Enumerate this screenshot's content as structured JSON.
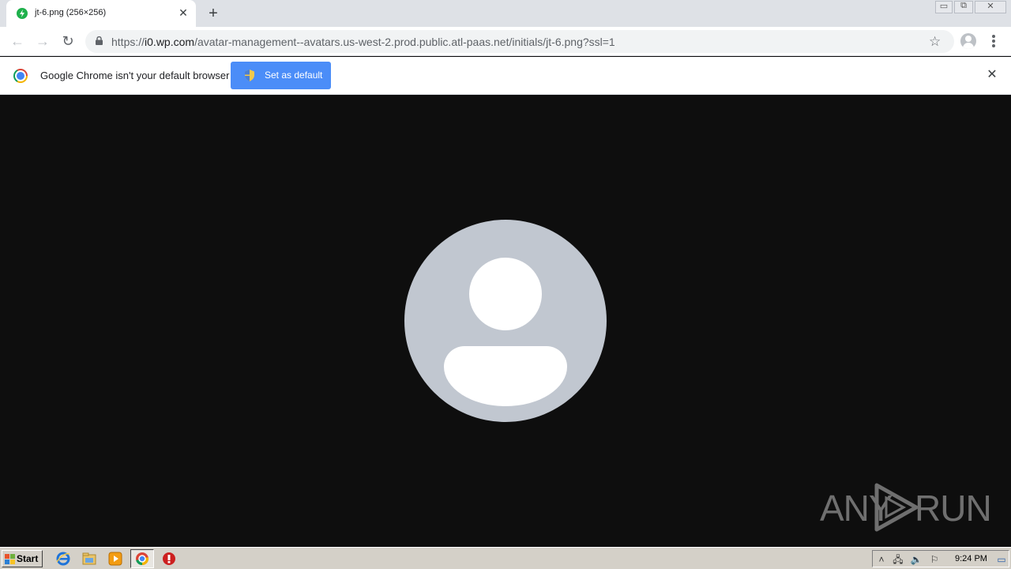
{
  "tab": {
    "title": "jt-6.png (256×256)",
    "close": "✕",
    "new_tab": "+"
  },
  "window": {
    "minimize": "▭",
    "maximize": "⧉",
    "close": "✕"
  },
  "toolbar": {
    "url_scheme": "https://",
    "url_host": "i0.wp.com",
    "url_path": "/avatar-management--avatars.us-west-2.prod.public.atl-paas.net/initials/jt-6.png?ssl=1",
    "back": "←",
    "forward": "→",
    "reload": "↻",
    "star": "☆"
  },
  "infobar": {
    "message": "Google Chrome isn't your default browser",
    "button_label": "Set as default",
    "close": "✕"
  },
  "watermark": {
    "left": "ANY",
    "right": "RUN"
  },
  "taskbar": {
    "start_label": "Start",
    "clock": "9:24 PM",
    "tray_icons": [
      "show-hidden-icon",
      "network-icon",
      "volume-icon",
      "flag-icon"
    ]
  },
  "colors": {
    "tab_strip": "#dee1e6",
    "accent_button": "#4b8df8",
    "content_background": "#0e0e0e",
    "avatar_background": "#c1c7d0"
  }
}
